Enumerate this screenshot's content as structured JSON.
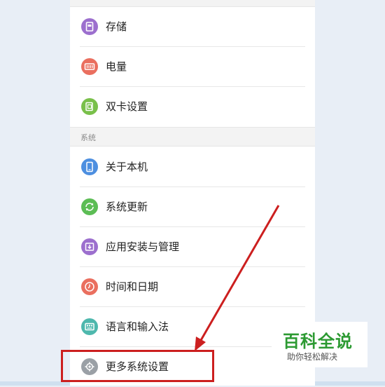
{
  "items_top": [
    {
      "label": "存储",
      "icon": "storage-icon",
      "color": "#9c6fce"
    },
    {
      "label": "电量",
      "icon": "battery-icon",
      "color": "#ea6f5f"
    },
    {
      "label": "双卡设置",
      "icon": "dual-sim-icon",
      "color": "#79c04a"
    }
  ],
  "section": {
    "title": "系统"
  },
  "items_system": [
    {
      "label": "关于本机",
      "icon": "phone-icon",
      "color": "#4d8fe0"
    },
    {
      "label": "系统更新",
      "icon": "refresh-icon",
      "color": "#5cbd55"
    },
    {
      "label": "应用安装与管理",
      "icon": "app-install-icon",
      "color": "#9c6fce"
    },
    {
      "label": "时间和日期",
      "icon": "clock-icon",
      "color": "#ea6f5f"
    },
    {
      "label": "语言和输入法",
      "icon": "keyboard-icon",
      "color": "#4eb8ad"
    },
    {
      "label": "更多系统设置",
      "icon": "gear-icon",
      "color": "#9aa0a6"
    }
  ],
  "watermark": {
    "title": "百科全说",
    "subtitle": "助你轻松解决"
  },
  "colors": {
    "highlight": "#cc1f1f",
    "watermark_green": "#2c9a32"
  }
}
